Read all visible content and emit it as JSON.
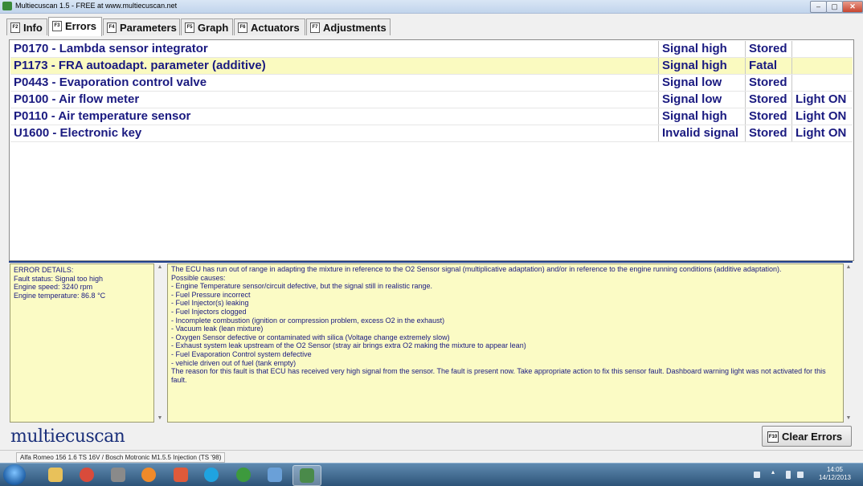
{
  "window": {
    "title": "Multiecuscan 1.5 - FREE at www.multiecuscan.net",
    "min_glyph": "‒",
    "max_glyph": "▢",
    "close_glyph": "✕"
  },
  "tabs": [
    {
      "key": "F2",
      "label": "Info",
      "active": false
    },
    {
      "key": "F3",
      "label": "Errors",
      "active": true
    },
    {
      "key": "F4",
      "label": "Parameters",
      "active": false
    },
    {
      "key": "F5",
      "label": "Graph",
      "active": false
    },
    {
      "key": "F6",
      "label": "Actuators",
      "active": false
    },
    {
      "key": "F7",
      "label": "Adjustments",
      "active": false
    }
  ],
  "errors": [
    {
      "code": "P0170 - Lambda sensor integrator",
      "signal": "Signal high",
      "status": "Stored",
      "light": ""
    },
    {
      "code": "P1173 - FRA autoadapt. parameter (additive)",
      "signal": "Signal high",
      "status": "Fatal",
      "light": ""
    },
    {
      "code": "P0443 - Evaporation control valve",
      "signal": "Signal low",
      "status": "Stored",
      "light": ""
    },
    {
      "code": "P0100 - Air flow meter",
      "signal": "Signal low",
      "status": "Stored",
      "light": "Light ON"
    },
    {
      "code": "P0110 - Air temperature sensor",
      "signal": "Signal high",
      "status": "Stored",
      "light": "Light ON"
    },
    {
      "code": "U1600 - Electronic key",
      "signal": "Invalid signal",
      "status": "Stored",
      "light": "Light ON"
    }
  ],
  "details": {
    "lines": [
      "ERROR DETAILS:",
      "Fault status: Signal too high",
      "Engine speed: 3240 rpm",
      "Engine temperature: 86.8 °C"
    ]
  },
  "description": {
    "lines": [
      "The ECU has run out of range in adapting the mixture in reference to the O2 Sensor signal (multiplicative adaptation) and/or in reference to the engine running conditions (additive adaptation).",
      "Possible causes:",
      "- Engine Temperature sensor/circuit defective, but the signal still in realistic range.",
      "- Fuel Pressure incorrect",
      "- Fuel Injector(s) leaking",
      "- Fuel Injectors clogged",
      "- Incomplete combustion (ignition or compression problem, excess O2 in the exhaust)",
      "- Vacuum leak (lean mixture)",
      "- Oxygen Sensor defective or contaminated with silica (Voltage change extremely slow)",
      "- Exhaust system leak upstream of the O2 Sensor (stray air brings extra O2 making the mixture to appear lean)",
      "- Fuel Evaporation Control system defective",
      "- vehicle driven out of fuel (tank empty)",
      "The reason for this fault is that ECU has received very high signal from the sensor. The fault is present now. Take appropriate action to fix this sensor fault. Dashboard warning light was not activated for this fault."
    ]
  },
  "brand": "multiecuscan",
  "clear_button": {
    "key": "F10",
    "label": "Clear Errors"
  },
  "status_bar": "Alfa Romeo 156 1.6 TS 16V / Bosch Motronic M1.5.5 Injection (TS '98)",
  "taskbar": {
    "items": [
      {
        "name": "explorer-icon",
        "color": "#e8c15a"
      },
      {
        "name": "chrome-icon",
        "color": "#d94b3b"
      },
      {
        "name": "film-icon",
        "color": "#8a8a8a"
      },
      {
        "name": "media-player-icon",
        "color": "#f08a2a"
      },
      {
        "name": "paint-icon",
        "color": "#e05a3a"
      },
      {
        "name": "skype-icon",
        "color": "#1fa3e0"
      },
      {
        "name": "utorrent-icon",
        "color": "#3d9a3d"
      },
      {
        "name": "remote-desktop-icon",
        "color": "#6aa0d8"
      },
      {
        "name": "multiecuscan-icon",
        "color": "#4a8a4a"
      }
    ],
    "clock_time": "14:05",
    "clock_date": "14/12/2013"
  },
  "colors": {
    "accent_text": "#1a1a80",
    "selected_row": "#fafac0",
    "panel_bg": "#fbfbc5"
  }
}
